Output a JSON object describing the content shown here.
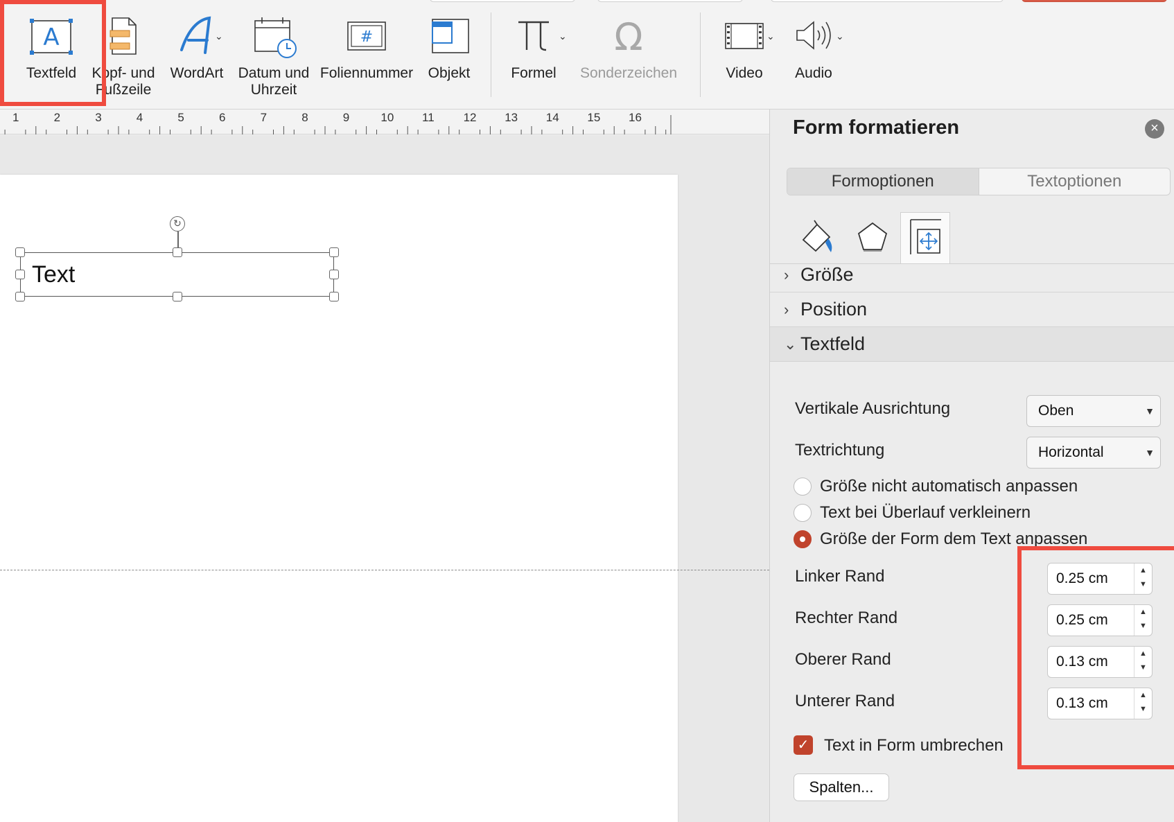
{
  "ribbon": {
    "buttons": [
      {
        "label": "Textfeld",
        "icon": "textbox-icon"
      },
      {
        "label": "Kopf- und Fußzeile",
        "icon": "header-footer-icon"
      },
      {
        "label": "WordArt",
        "icon": "wordart-icon"
      },
      {
        "label": "Datum und Uhrzeit",
        "icon": "calendar-clock-icon"
      },
      {
        "label": "Foliennummer",
        "icon": "slide-number-icon"
      },
      {
        "label": "Objekt",
        "icon": "object-icon"
      },
      {
        "label": "Formel",
        "icon": "pi-icon"
      },
      {
        "label": "Sonderzeichen",
        "icon": "omega-icon"
      },
      {
        "label": "Video",
        "icon": "film-icon"
      },
      {
        "label": "Audio",
        "icon": "speaker-icon"
      }
    ],
    "textbox_glyph": "A",
    "slide_number_glyph": "#"
  },
  "ruler": {
    "numbers": [
      "1",
      "2",
      "3",
      "4",
      "5",
      "6",
      "7",
      "8",
      "9",
      "10",
      "11",
      "12",
      "13",
      "14",
      "15",
      "16"
    ]
  },
  "slide": {
    "textbox_text": "Text"
  },
  "pane": {
    "title": "Form formatieren",
    "tabs": [
      "Formoptionen",
      "Textoptionen"
    ],
    "icon_tabs": [
      "fill-line-icon",
      "effects-pentagon-icon",
      "size-properties-icon"
    ],
    "sections": {
      "size": "Größe",
      "position": "Position",
      "textbox": "Textfeld"
    },
    "vertical_alignment": {
      "label": "Vertikale Ausrichtung",
      "value": "Oben"
    },
    "text_direction": {
      "label": "Textrichtung",
      "value": "Horizontal"
    },
    "autofit_options": [
      {
        "label": "Größe nicht automatisch anpassen",
        "selected": false
      },
      {
        "label": "Text bei Überlauf verkleinern",
        "selected": false
      },
      {
        "label": "Größe der Form dem Text anpassen",
        "selected": true
      }
    ],
    "margins": [
      {
        "label": "Linker Rand",
        "value": "0.25 cm"
      },
      {
        "label": "Rechter Rand",
        "value": "0.25 cm"
      },
      {
        "label": "Oberer Rand",
        "value": "0.13 cm"
      },
      {
        "label": "Unterer Rand",
        "value": "0.13 cm"
      }
    ],
    "wrap_text": {
      "label": "Text in Form umbrechen",
      "checked": true
    },
    "columns_button": "Spalten..."
  },
  "colors": {
    "accent": "#c0432c",
    "highlight": "#ef4b3f"
  }
}
